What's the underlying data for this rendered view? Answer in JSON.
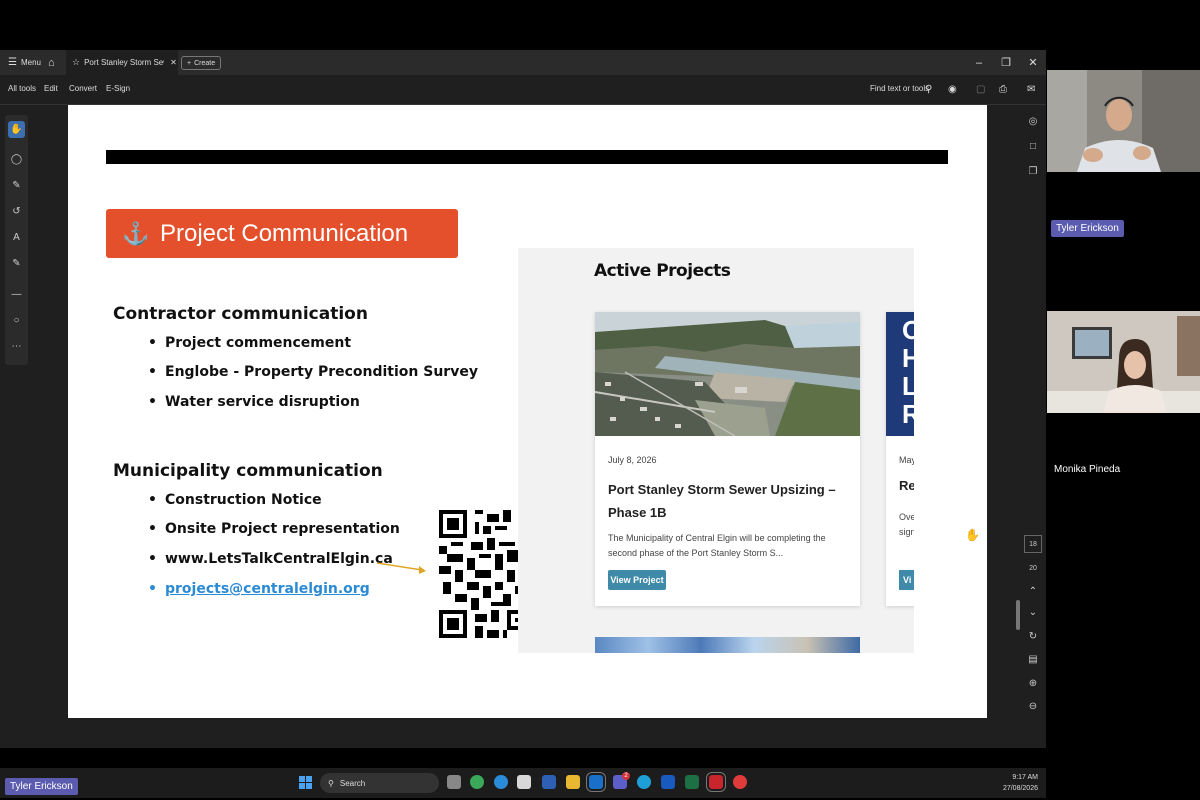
{
  "app": {
    "menu_label": "Menu",
    "tab_title": "Port Stanley Storm Sew...",
    "create_label": "Create",
    "menubar": [
      "All tools",
      "Edit",
      "Convert",
      "E-Sign"
    ],
    "find_label": "Find text or tools",
    "page_number": "18",
    "page_total": "20"
  },
  "slide": {
    "title": "Project Communication",
    "contractor_heading": "Contractor communication",
    "contractor_items": [
      "Project commencement",
      "Englobe - Property Precondition Survey",
      "Water service disruption"
    ],
    "municipality_heading": "Municipality communication",
    "municipality_items": [
      "Construction Notice",
      "Onsite Project representation",
      "www.LetsTalkCentralElgin.ca",
      "projects@centralelgin.org"
    ]
  },
  "projects_panel": {
    "heading": "Active Projects",
    "card1": {
      "date": "July 8, 2026",
      "title": "Port Stanley Storm Sewer Upsizing – Phase 1B",
      "description": "The Municipality of Central Elgin will be completing the second phase of the Port Stanley Storm S...",
      "button": "View Project"
    },
    "card2": {
      "img_letters": "O H L R",
      "date": "May",
      "title": "Re",
      "desc1": "Ove",
      "desc2": "sign",
      "button": "Vi"
    }
  },
  "taskbar": {
    "search_label": "Search",
    "time": "9:17 AM",
    "date": "27/08/2026",
    "badge": "2"
  },
  "participants": {
    "p1_name": "Tyler Erickson",
    "p2_name": "Monika Pineda",
    "bottom_name": "Tyler Erickson"
  },
  "colors": {
    "title_box": "#e4502b",
    "view_button": "#3f8aa8",
    "link": "#2b8ad4",
    "name_tag": "#5b5bb0"
  }
}
